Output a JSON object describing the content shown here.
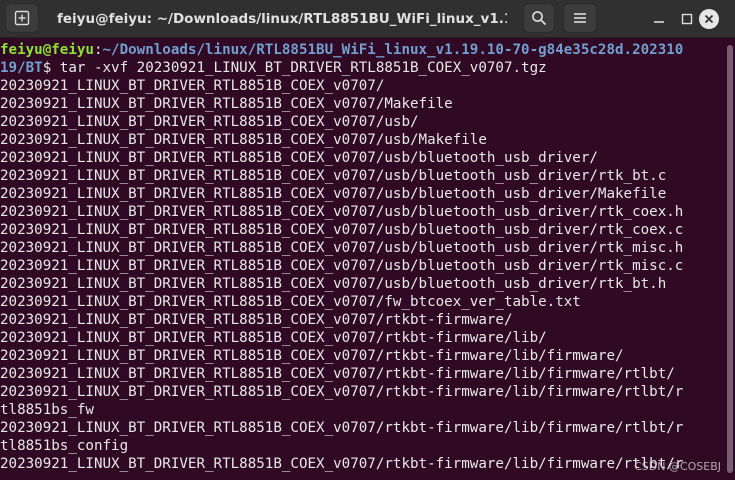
{
  "window": {
    "title": "feiyu@feiyu: ~/Downloads/linux/RTL8851BU_WiFi_linux_v1.1..."
  },
  "icons": {
    "new_tab": "new-tab-icon",
    "search": "search-icon",
    "menu": "hamburger-menu-icon",
    "minimize": "minimize-icon",
    "maximize": "maximize-icon",
    "close": "close-icon"
  },
  "colors": {
    "background": "#300a24",
    "prompt_user": "#8ae234",
    "prompt_path": "#729fcf",
    "text": "#e8e8e8"
  },
  "terminal": {
    "prompt": {
      "user_host": "feiyu@feiyu",
      "colon": ":",
      "path_line1": "~/Downloads/linux/RTL8851BU_WiFi_linux_v1.19.10-70-g84e35c28d.202310",
      "path_line2": "19/BT",
      "symbol": "$",
      "command": " tar -xvf 20230921_LINUX_BT_DRIVER_RTL8851B_COEX_v0707.tgz"
    },
    "output": [
      "20230921_LINUX_BT_DRIVER_RTL8851B_COEX_v0707/",
      "20230921_LINUX_BT_DRIVER_RTL8851B_COEX_v0707/Makefile",
      "20230921_LINUX_BT_DRIVER_RTL8851B_COEX_v0707/usb/",
      "20230921_LINUX_BT_DRIVER_RTL8851B_COEX_v0707/usb/Makefile",
      "20230921_LINUX_BT_DRIVER_RTL8851B_COEX_v0707/usb/bluetooth_usb_driver/",
      "20230921_LINUX_BT_DRIVER_RTL8851B_COEX_v0707/usb/bluetooth_usb_driver/rtk_bt.c",
      "20230921_LINUX_BT_DRIVER_RTL8851B_COEX_v0707/usb/bluetooth_usb_driver/Makefile",
      "20230921_LINUX_BT_DRIVER_RTL8851B_COEX_v0707/usb/bluetooth_usb_driver/rtk_coex.h",
      "20230921_LINUX_BT_DRIVER_RTL8851B_COEX_v0707/usb/bluetooth_usb_driver/rtk_coex.c",
      "20230921_LINUX_BT_DRIVER_RTL8851B_COEX_v0707/usb/bluetooth_usb_driver/rtk_misc.h",
      "20230921_LINUX_BT_DRIVER_RTL8851B_COEX_v0707/usb/bluetooth_usb_driver/rtk_misc.c",
      "20230921_LINUX_BT_DRIVER_RTL8851B_COEX_v0707/usb/bluetooth_usb_driver/rtk_bt.h",
      "20230921_LINUX_BT_DRIVER_RTL8851B_COEX_v0707/fw_btcoex_ver_table.txt",
      "20230921_LINUX_BT_DRIVER_RTL8851B_COEX_v0707/rtkbt-firmware/",
      "20230921_LINUX_BT_DRIVER_RTL8851B_COEX_v0707/rtkbt-firmware/lib/",
      "20230921_LINUX_BT_DRIVER_RTL8851B_COEX_v0707/rtkbt-firmware/lib/firmware/",
      "20230921_LINUX_BT_DRIVER_RTL8851B_COEX_v0707/rtkbt-firmware/lib/firmware/rtlbt/",
      "20230921_LINUX_BT_DRIVER_RTL8851B_COEX_v0707/rtkbt-firmware/lib/firmware/rtlbt/r",
      "tl8851bs_fw",
      "20230921_LINUX_BT_DRIVER_RTL8851B_COEX_v0707/rtkbt-firmware/lib/firmware/rtlbt/r",
      "tl8851bs_config",
      "20230921_LINUX_BT_DRIVER_RTL8851B_COEX_v0707/rtkbt-firmware/lib/firmware/rtlbt/r"
    ]
  },
  "watermark": "CSDN @COSEBJ"
}
